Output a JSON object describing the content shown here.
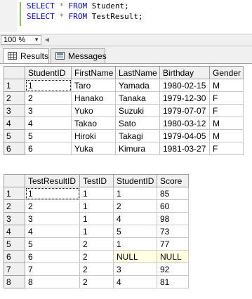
{
  "editor": {
    "lines": [
      {
        "kw1": "SELECT",
        "op": "*",
        "kw2": "FROM",
        "table": "Student;"
      },
      {
        "kw1": "SELECT",
        "op": "*",
        "kw2": "FROM",
        "table": "TestResult;"
      }
    ]
  },
  "zoom": {
    "value": "100 %"
  },
  "tabs": [
    {
      "label": "Results",
      "icon": "results-grid-icon",
      "active": true
    },
    {
      "label": "Messages",
      "icon": "messages-icon",
      "active": false
    }
  ],
  "students": {
    "columns": [
      "StudentID",
      "FirstName",
      "LastName",
      "Birthday",
      "Gender"
    ],
    "rows": [
      [
        "1",
        "Taro",
        "Yamada",
        "1980-02-15",
        "M"
      ],
      [
        "2",
        "Hanako",
        "Tanaka",
        "1979-12-30",
        "F"
      ],
      [
        "3",
        "Yuko",
        "Suzuki",
        "1979-07-07",
        "F"
      ],
      [
        "4",
        "Takao",
        "Sato",
        "1980-03-12",
        "M"
      ],
      [
        "5",
        "Hiroki",
        "Takagi",
        "1979-04-05",
        "M"
      ],
      [
        "6",
        "Yuka",
        "Kimura",
        "1981-03-27",
        "F"
      ]
    ]
  },
  "results": {
    "columns": [
      "TestResultID",
      "TestID",
      "StudentID",
      "Score"
    ],
    "rows": [
      [
        "1",
        "1",
        "1",
        "85"
      ],
      [
        "2",
        "1",
        "2",
        "60"
      ],
      [
        "3",
        "1",
        "4",
        "98"
      ],
      [
        "4",
        "1",
        "5",
        "73"
      ],
      [
        "5",
        "2",
        "1",
        "77"
      ],
      [
        "6",
        "2",
        "NULL",
        "NULL"
      ],
      [
        "7",
        "2",
        "3",
        "92"
      ],
      [
        "8",
        "2",
        "4",
        "81"
      ]
    ]
  },
  "colors": {
    "keyword": "#0000ff",
    "null_bg": "#ffffe1",
    "header_bg": "#f0f0f0"
  }
}
